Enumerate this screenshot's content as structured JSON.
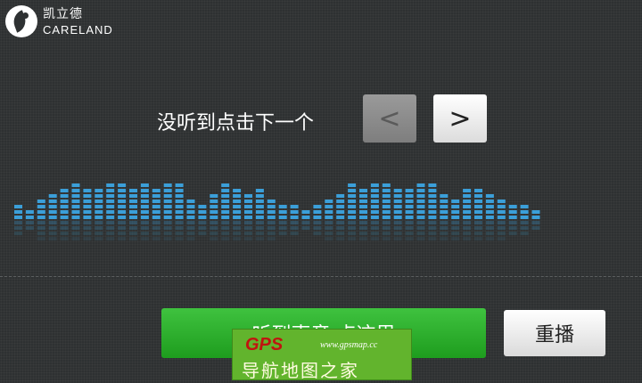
{
  "brand": {
    "name_cn": "凯立德",
    "name_en": "CARELAND"
  },
  "prompt": {
    "text": "没听到点击下一个"
  },
  "nav": {
    "prev_glyph": "<",
    "next_glyph": ">"
  },
  "actions": {
    "confirm_label": "听到声音,点这里",
    "replay_label": "重播"
  },
  "watermark": {
    "logo": "GPS",
    "url": "www.gpsmap.cc",
    "text": "导航地图之家"
  },
  "equalizer": {
    "bar_color": "#3b9fd9",
    "levels": [
      3,
      2,
      4,
      5,
      6,
      7,
      6,
      6,
      7,
      7,
      6,
      7,
      6,
      7,
      7,
      4,
      3,
      5,
      7,
      6,
      5,
      6,
      4,
      3,
      3,
      2,
      3,
      4,
      5,
      7,
      6,
      7,
      7,
      6,
      6,
      7,
      7,
      5,
      4,
      6,
      6,
      5,
      4,
      3,
      3,
      2
    ]
  },
  "colors": {
    "background": "#2e3132",
    "confirm": "#2ab02a",
    "accent_bar": "#3b9fd9"
  }
}
